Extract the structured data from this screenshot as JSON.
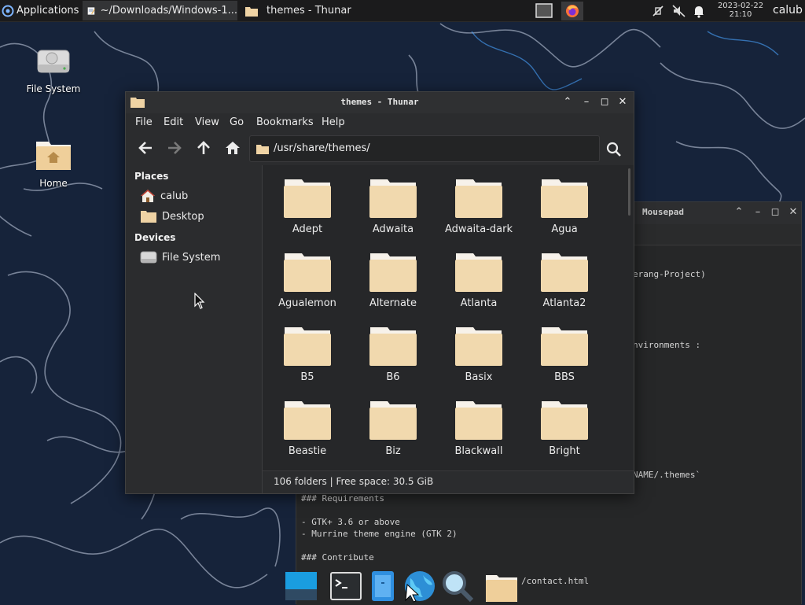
{
  "top_panel": {
    "applications_label": "Applications",
    "tasks": [
      {
        "label": "~/Downloads/Windows-1...",
        "active": true
      },
      {
        "label": "themes - Thunar",
        "active": false
      }
    ],
    "clock_date": "2023-02-22",
    "clock_time": "21:10",
    "user": "calub"
  },
  "desktop": {
    "icons": [
      {
        "label": "File System"
      },
      {
        "label": "Home"
      }
    ]
  },
  "mousepad": {
    "title": "Mousepad",
    "lines": [
      "erang-Project)",
      "nvironments :",
      "NAME/.themes`",
      "### Requirements",
      "- GTK+ 3.6 or above",
      "- Murrine theme engine (GTK 2)",
      "### Contribute",
      "/contact.html"
    ]
  },
  "thunar": {
    "title": "themes - Thunar",
    "menu": [
      "File",
      "Edit",
      "View",
      "Go",
      "Bookmarks",
      "Help"
    ],
    "location": "/usr/share/themes/",
    "places_heading": "Places",
    "places": [
      {
        "label": "calub"
      },
      {
        "label": "Desktop"
      }
    ],
    "devices_heading": "Devices",
    "devices": [
      {
        "label": "File System"
      }
    ],
    "folders": [
      "Adept",
      "Adwaita",
      "Adwaita-dark",
      "Agua",
      "Agualemon",
      "Alternate",
      "Atlanta",
      "Atlanta2",
      "B5",
      "B6",
      "Basix",
      "BBS",
      "Beastie",
      "Biz",
      "Blackwall",
      "Bright"
    ],
    "status": "106 folders  |  Free space: 30.5 GiB"
  },
  "colors": {
    "panel_bg": "#1b1b1c",
    "window_bg": "#2b2c2e",
    "folder_body": "#f1d9ae",
    "folder_tab": "#f7f2ea",
    "wallpaper_bg": "#16233a"
  }
}
